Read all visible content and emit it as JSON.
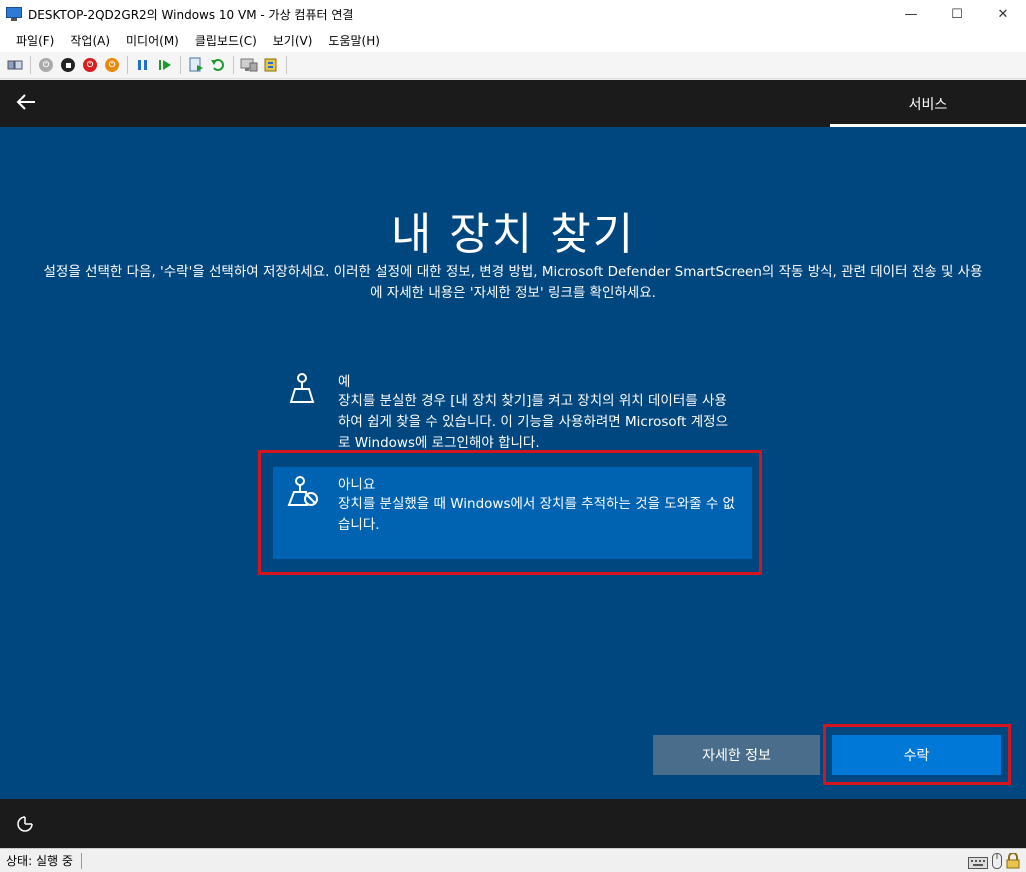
{
  "window": {
    "title": "DESKTOP-2QD2GR2의 Windows 10 VM - 가상 컴퓨터 연결",
    "minimize": "—",
    "maximize": "☐",
    "close": "✕"
  },
  "menu": {
    "items": [
      "파일(F)",
      "작업(A)",
      "미디어(M)",
      "클립보드(C)",
      "보기(V)",
      "도움말(H)"
    ]
  },
  "toolbar": {
    "icons": [
      "ctrl-alt-del-icon",
      "start-icon",
      "turn-off-icon",
      "shutdown-icon",
      "save-icon",
      "pause-icon",
      "reset-icon",
      "checkpoint-icon",
      "revert-icon",
      "enhanced-session-icon",
      "share-icon"
    ]
  },
  "oobe": {
    "header_tab": "서비스",
    "title": "내 장치 찾기",
    "description": "설정을 선택한 다음, '수락'을 선택하여 저장하세요. 이러한 설정에 대한 정보, 변경 방법, Microsoft Defender SmartScreen의 작동 방식, 관련 데이터 전송 및 사용에 자세한 내용은 '자세한 정보' 링크를 확인하세요.",
    "options": [
      {
        "title": "예",
        "description": "장치를 분실한 경우 [내 장치 찾기]를 켜고 장치의 위치 데이터를 사용하여 쉽게 찾을 수 있습니다. 이 기능을 사용하려면 Microsoft 계정으로 Windows에 로그인해야 합니다."
      },
      {
        "title": "아니요",
        "description": "장치를 분실했을 때 Windows에서 장치를 추적하는 것을 도와줄 수 없습니다."
      }
    ],
    "learn_more": "자세한 정보",
    "accept": "수락"
  },
  "status": {
    "text": "상태: 실행 중"
  },
  "colors": {
    "background": "#00467f",
    "selected_option": "#0063b1",
    "accept_button": "#0078d7",
    "learn_more_button": "#4a6d8c",
    "highlight": "#d4161c"
  }
}
